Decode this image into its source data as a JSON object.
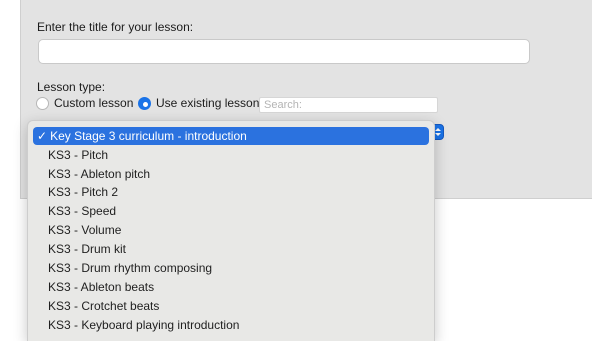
{
  "form": {
    "title_label": "Enter the title for your lesson:",
    "title_value": "",
    "type_label": "Lesson type:",
    "radio_custom": "Custom lesson",
    "radio_existing": "Use existing lesson",
    "selected_type": "Use existing lesson",
    "search_placeholder": "Search:"
  },
  "dropdown": {
    "checkmark": "✓",
    "selected_label": "Key Stage 3 curriculum - introduction",
    "items": [
      "KS3 - Pitch",
      "KS3 - Ableton pitch",
      "KS3 - Pitch 2",
      "KS3 - Speed",
      "KS3 - Volume",
      "KS3 - Drum kit",
      "KS3 - Drum rhythm composing",
      "KS3 - Ableton beats",
      "KS3 - Crotchet beats",
      "KS3 - Keyboard playing introduction"
    ]
  },
  "colors": {
    "accent": "#2b72df",
    "panel": "#e3e3e3",
    "menu_bg": "#e8e8e6"
  }
}
